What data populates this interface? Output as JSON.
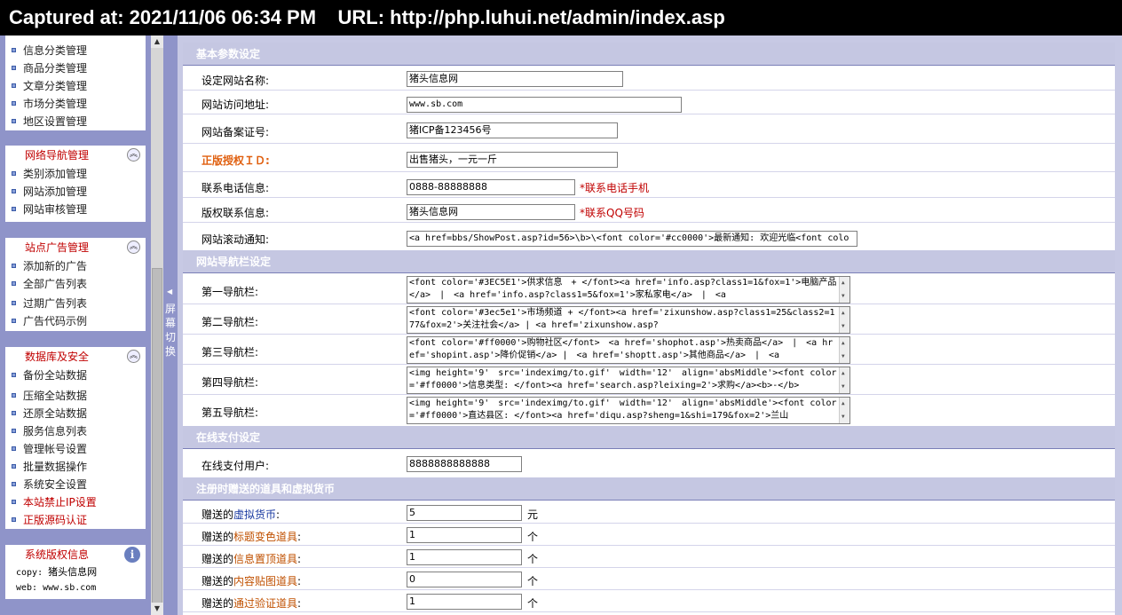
{
  "caption": "Captured at: 2021/11/06 06:34 PM    URL: http://php.luhui.net/admin/index.asp",
  "sidebar": {
    "group0": {
      "items": [
        "信息分类管理",
        "商品分类管理",
        "文章分类管理",
        "市场分类管理",
        "地区设置管理"
      ]
    },
    "group1": {
      "title": "网络导航管理",
      "items": [
        "类别添加管理",
        "网站添加管理",
        "网站审核管理"
      ]
    },
    "group2": {
      "title": "站点广告管理",
      "items": [
        "添加新的广告",
        "全部广告列表",
        "过期广告列表",
        "广告代码示例"
      ]
    },
    "group3": {
      "title": "数据库及安全",
      "items": [
        "备份全站数据",
        "压缩全站数据",
        "还原全站数据",
        "服务信息列表",
        "管理帐号设置",
        "批量数据操作",
        "系统安全设置",
        "本站禁止IP设置",
        "正版源码认证"
      ]
    },
    "group4": {
      "title": "系统版权信息",
      "copy_label": "copy:",
      "copy_value": "猪头信息网",
      "web_label": "web:",
      "web_value": "www.sb.com"
    }
  },
  "splitter": {
    "label": "屏幕切换"
  },
  "sections": {
    "basic": {
      "title": "基本参数设定",
      "site_name": {
        "label": "设定网站名称:",
        "value": "猪头信息网"
      },
      "site_url": {
        "label": "网站访问地址:",
        "value": "www.sb.com"
      },
      "icp": {
        "label": "网站备案证号:",
        "value": "猪ICP备123456号"
      },
      "license": {
        "label": "正版授权ＩＤ:",
        "value": "出售猪头，一元一斤"
      },
      "phone": {
        "label": "联系电话信息:",
        "value": "0888-88888888",
        "note": "*联系电话手机"
      },
      "copyright": {
        "label": "版权联系信息:",
        "value": "猪头信息网",
        "note": "*联系QQ号码"
      },
      "notice": {
        "label": "网站滚动通知:",
        "value": "<a href=bbs/ShowPost.asp?id=56>\\b>\\<font color='#cc0000'>最新通知: 欢迎光临<font colo"
      }
    },
    "nav": {
      "title": "网站导航栏设定",
      "rows": [
        {
          "label": "第一导航栏:",
          "value": "<font color='#3EC5E1'>供求信息　+ </font><a href='info.asp?class1=1&fox=1'>电脑产品</a>　|　<a href='info.asp?class1=5&fox=1'>家私家电</a>　|　<a"
        },
        {
          "label": "第二导航栏:",
          "value": "<font color='#3ec5e1'>市场频道 + </font><a href='zixunshow.asp?class1=25&class2=177&fox=2'>关注社会</a> | <a href='zixunshow.asp?"
        },
        {
          "label": "第三导航栏:",
          "value": "<font color='#ff0000'>购物社区</font>　<a href='shophot.asp'>热卖商品</a>　|　<a href='shopint.asp'>降价促销</a> |　<a href='shoptt.asp'>其他商品</a>　|　<a"
        },
        {
          "label": "第四导航栏:",
          "value": "<img height='9'　src='indeximg/to.gif'　width='12'　align='absMiddle'><font color='#ff0000'>信息类型: </font><a href='search.asp?leixing=2'>求购</a><b>-</b>"
        },
        {
          "label": "第五导航栏:",
          "value": "<img height='9'　src='indeximg/to.gif'　width='12'　align='absMiddle'><font color='#ff0000'>直达县区: </font><a href='diqu.asp?sheng=1&shi=179&fox=2'>兰山"
        }
      ]
    },
    "pay": {
      "title": "在线支付设定",
      "user": {
        "label": "在线支付用户:",
        "value": "8888888888888"
      }
    },
    "gift": {
      "title": "注册时赠送的道具和虚拟货币",
      "rows": [
        {
          "pre": "赠送的",
          "em": "虚拟货币",
          "post": ":",
          "value": "5",
          "unit": "元"
        },
        {
          "pre": "赠送的",
          "em": "标题变色道具",
          "post": ":",
          "value": "1",
          "unit": "个"
        },
        {
          "pre": "赠送的",
          "em": "信息置顶道具",
          "post": ":",
          "value": "1",
          "unit": "个"
        },
        {
          "pre": "赠送的",
          "em": "内容贴图道具",
          "post": ":",
          "value": "0",
          "unit": "个"
        },
        {
          "pre": "赠送的",
          "em": "通过验证道具",
          "post": ":",
          "value": "1",
          "unit": "个"
        }
      ]
    }
  }
}
